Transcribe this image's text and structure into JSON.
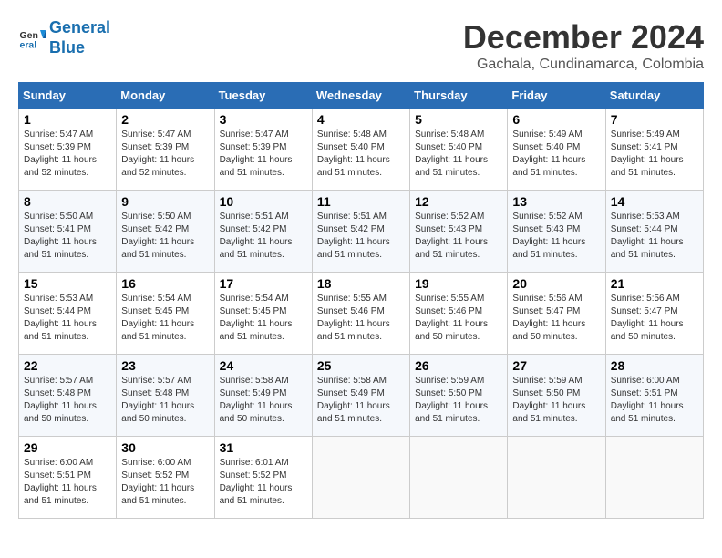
{
  "logo": {
    "line1": "General",
    "line2": "Blue"
  },
  "title": "December 2024",
  "subtitle": "Gachala, Cundinamarca, Colombia",
  "headers": [
    "Sunday",
    "Monday",
    "Tuesday",
    "Wednesday",
    "Thursday",
    "Friday",
    "Saturday"
  ],
  "weeks": [
    [
      {
        "day": "1",
        "info": "Sunrise: 5:47 AM\nSunset: 5:39 PM\nDaylight: 11 hours\nand 52 minutes."
      },
      {
        "day": "2",
        "info": "Sunrise: 5:47 AM\nSunset: 5:39 PM\nDaylight: 11 hours\nand 52 minutes."
      },
      {
        "day": "3",
        "info": "Sunrise: 5:47 AM\nSunset: 5:39 PM\nDaylight: 11 hours\nand 51 minutes."
      },
      {
        "day": "4",
        "info": "Sunrise: 5:48 AM\nSunset: 5:40 PM\nDaylight: 11 hours\nand 51 minutes."
      },
      {
        "day": "5",
        "info": "Sunrise: 5:48 AM\nSunset: 5:40 PM\nDaylight: 11 hours\nand 51 minutes."
      },
      {
        "day": "6",
        "info": "Sunrise: 5:49 AM\nSunset: 5:40 PM\nDaylight: 11 hours\nand 51 minutes."
      },
      {
        "day": "7",
        "info": "Sunrise: 5:49 AM\nSunset: 5:41 PM\nDaylight: 11 hours\nand 51 minutes."
      }
    ],
    [
      {
        "day": "8",
        "info": "Sunrise: 5:50 AM\nSunset: 5:41 PM\nDaylight: 11 hours\nand 51 minutes."
      },
      {
        "day": "9",
        "info": "Sunrise: 5:50 AM\nSunset: 5:42 PM\nDaylight: 11 hours\nand 51 minutes."
      },
      {
        "day": "10",
        "info": "Sunrise: 5:51 AM\nSunset: 5:42 PM\nDaylight: 11 hours\nand 51 minutes."
      },
      {
        "day": "11",
        "info": "Sunrise: 5:51 AM\nSunset: 5:42 PM\nDaylight: 11 hours\nand 51 minutes."
      },
      {
        "day": "12",
        "info": "Sunrise: 5:52 AM\nSunset: 5:43 PM\nDaylight: 11 hours\nand 51 minutes."
      },
      {
        "day": "13",
        "info": "Sunrise: 5:52 AM\nSunset: 5:43 PM\nDaylight: 11 hours\nand 51 minutes."
      },
      {
        "day": "14",
        "info": "Sunrise: 5:53 AM\nSunset: 5:44 PM\nDaylight: 11 hours\nand 51 minutes."
      }
    ],
    [
      {
        "day": "15",
        "info": "Sunrise: 5:53 AM\nSunset: 5:44 PM\nDaylight: 11 hours\nand 51 minutes."
      },
      {
        "day": "16",
        "info": "Sunrise: 5:54 AM\nSunset: 5:45 PM\nDaylight: 11 hours\nand 51 minutes."
      },
      {
        "day": "17",
        "info": "Sunrise: 5:54 AM\nSunset: 5:45 PM\nDaylight: 11 hours\nand 51 minutes."
      },
      {
        "day": "18",
        "info": "Sunrise: 5:55 AM\nSunset: 5:46 PM\nDaylight: 11 hours\nand 51 minutes."
      },
      {
        "day": "19",
        "info": "Sunrise: 5:55 AM\nSunset: 5:46 PM\nDaylight: 11 hours\nand 50 minutes."
      },
      {
        "day": "20",
        "info": "Sunrise: 5:56 AM\nSunset: 5:47 PM\nDaylight: 11 hours\nand 50 minutes."
      },
      {
        "day": "21",
        "info": "Sunrise: 5:56 AM\nSunset: 5:47 PM\nDaylight: 11 hours\nand 50 minutes."
      }
    ],
    [
      {
        "day": "22",
        "info": "Sunrise: 5:57 AM\nSunset: 5:48 PM\nDaylight: 11 hours\nand 50 minutes."
      },
      {
        "day": "23",
        "info": "Sunrise: 5:57 AM\nSunset: 5:48 PM\nDaylight: 11 hours\nand 50 minutes."
      },
      {
        "day": "24",
        "info": "Sunrise: 5:58 AM\nSunset: 5:49 PM\nDaylight: 11 hours\nand 50 minutes."
      },
      {
        "day": "25",
        "info": "Sunrise: 5:58 AM\nSunset: 5:49 PM\nDaylight: 11 hours\nand 51 minutes."
      },
      {
        "day": "26",
        "info": "Sunrise: 5:59 AM\nSunset: 5:50 PM\nDaylight: 11 hours\nand 51 minutes."
      },
      {
        "day": "27",
        "info": "Sunrise: 5:59 AM\nSunset: 5:50 PM\nDaylight: 11 hours\nand 51 minutes."
      },
      {
        "day": "28",
        "info": "Sunrise: 6:00 AM\nSunset: 5:51 PM\nDaylight: 11 hours\nand 51 minutes."
      }
    ],
    [
      {
        "day": "29",
        "info": "Sunrise: 6:00 AM\nSunset: 5:51 PM\nDaylight: 11 hours\nand 51 minutes."
      },
      {
        "day": "30",
        "info": "Sunrise: 6:00 AM\nSunset: 5:52 PM\nDaylight: 11 hours\nand 51 minutes."
      },
      {
        "day": "31",
        "info": "Sunrise: 6:01 AM\nSunset: 5:52 PM\nDaylight: 11 hours\nand 51 minutes."
      },
      null,
      null,
      null,
      null
    ]
  ]
}
